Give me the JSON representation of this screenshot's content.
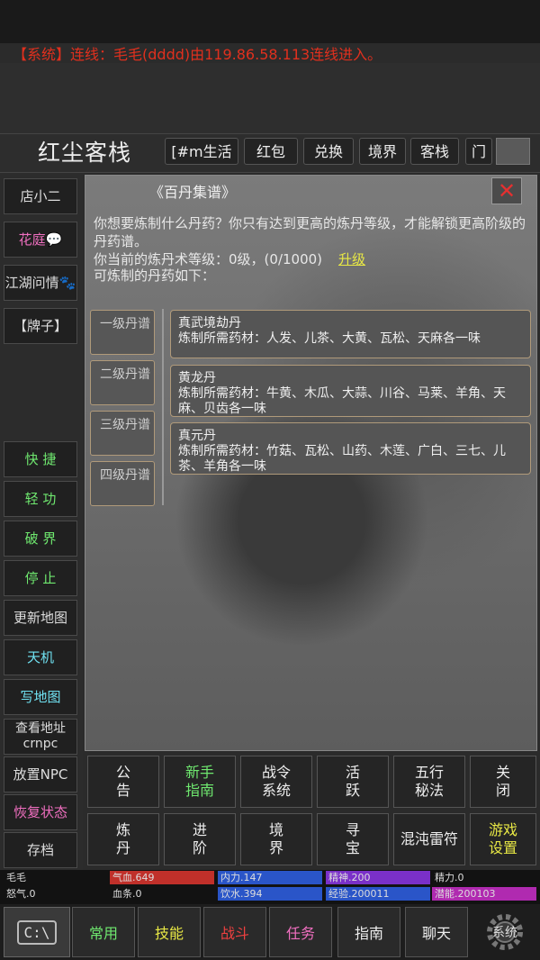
{
  "system_message": {
    "tag": "【系统】",
    "text": "连线：毛毛(dddd)由119.86.58.113连线进入。"
  },
  "header": {
    "title": "红尘客栈",
    "buttons": [
      "[#m生活",
      "红包",
      "兑换",
      "境界",
      "客栈",
      "门"
    ]
  },
  "sidebar": {
    "items": [
      {
        "label": "店小二",
        "color": "white"
      },
      {
        "label": "花庭💬",
        "color": "pink"
      },
      {
        "label": "江湖问情🐾",
        "color": "white"
      },
      {
        "label": "【牌子】",
        "color": "white"
      },
      {
        "label": "快 捷",
        "color": "green"
      },
      {
        "label": "轻 功",
        "color": "green"
      },
      {
        "label": "破 界",
        "color": "green"
      },
      {
        "label": "停 止",
        "color": "green"
      },
      {
        "label": "更新地图",
        "color": "white"
      },
      {
        "label": "天机",
        "color": "cyan"
      },
      {
        "label": "写地图",
        "color": "cyan"
      },
      {
        "label": "查看地址crnpc",
        "color": "white"
      },
      {
        "label": "放置NPC",
        "color": "white"
      },
      {
        "label": "恢复状态",
        "color": "pink"
      },
      {
        "label": "存档",
        "color": "white"
      }
    ]
  },
  "panel": {
    "title": "《百丹集谱》",
    "close": "✕",
    "intro": "你想要炼制什么丹药？你只有达到更高的炼丹等级，才能解锁更高阶级的丹药谱。",
    "level_line": "你当前的炼丹术等级：0级，(0/1000)",
    "upgrade": "升级",
    "available": "可炼制的丹药如下：",
    "tabs": [
      "一级丹谱",
      "二级丹谱",
      "三级丹谱",
      "四级丹谱"
    ],
    "recipes": [
      {
        "name": "真武境劫丹",
        "materials": "炼制所需药材：人发、儿茶、大黄、瓦松、天麻各一味"
      },
      {
        "name": "黄龙丹",
        "materials": "炼制所需药材：牛黄、木瓜、大蒜、川谷、马莱、羊角、天麻、贝齿各一味"
      },
      {
        "name": "真元丹",
        "materials": "炼制所需药材：竹菇、瓦松、山药、木莲、广白、三七、儿茶、羊角各一味"
      }
    ]
  },
  "actions": {
    "row1": [
      {
        "label": "公\n告",
        "color": "white"
      },
      {
        "label": "新手\n指南",
        "color": "green"
      },
      {
        "label": "战令\n系统",
        "color": "white"
      },
      {
        "label": "活\n跃",
        "color": "white"
      },
      {
        "label": "五行\n秘法",
        "color": "white"
      },
      {
        "label": "关\n闭",
        "color": "white"
      }
    ],
    "row2": [
      {
        "label": "炼\n丹",
        "color": "white"
      },
      {
        "label": "进\n阶",
        "color": "white"
      },
      {
        "label": "境\n界",
        "color": "white"
      },
      {
        "label": "寻\n宝",
        "color": "white"
      },
      {
        "label": "混沌雷符",
        "color": "white"
      },
      {
        "label": "游戏\n设置",
        "color": "yellow"
      }
    ]
  },
  "stats": {
    "name": "毛毛",
    "rage": "怒气.0",
    "hp": {
      "label": "气血.649",
      "fill": 1.0,
      "color": "#c0302a"
    },
    "hp_bar": {
      "label": "血条.0"
    },
    "power": {
      "label": "内力.147",
      "fill": 1.0,
      "color": "#2a55c8"
    },
    "water": {
      "label": "饮水.394",
      "fill": 1.0,
      "color": "#2a55c8"
    },
    "spirit": {
      "label": "精神.200",
      "fill": 1.0,
      "color": "#7a30c8"
    },
    "exp": {
      "label": "经验.200011",
      "fill": 1.0,
      "color": "#2a55c8"
    },
    "energy": {
      "label": "精力.0"
    },
    "potential": {
      "label": "潜能.200103",
      "fill": 1.0,
      "color": "#b02ab0"
    }
  },
  "bottom_nav": {
    "console": "C:\\",
    "items": [
      {
        "label": "常用",
        "color": "green"
      },
      {
        "label": "技能",
        "color": "yellow"
      },
      {
        "label": "战斗",
        "color": "red"
      },
      {
        "label": "任务",
        "color": "pink"
      },
      {
        "label": "指南",
        "color": "white"
      },
      {
        "label": "聊天",
        "color": "white"
      }
    ],
    "system": "系统"
  }
}
